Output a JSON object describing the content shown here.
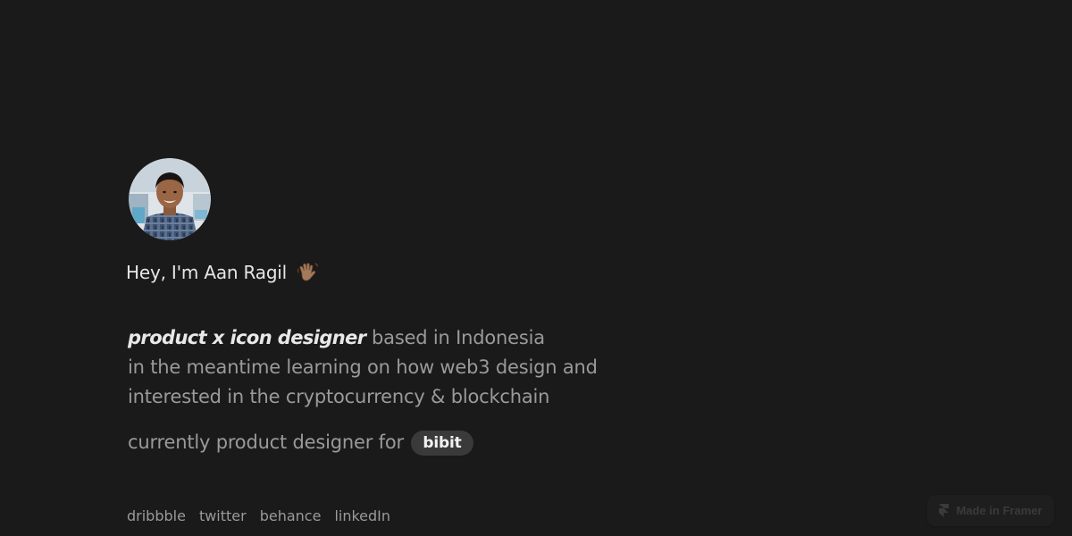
{
  "profile": {
    "greeting": "Hey, I'm Aan Ragil",
    "avatar_alt": "avatar"
  },
  "intro": {
    "role": "product x icon designer",
    "line1_rest": "based in Indonesia",
    "line2": "in the meantime learning on how web3 design and",
    "line3": "interested in the cryptocurrency & blockchain"
  },
  "current": {
    "prefix": "currently product designer for",
    "company": "bibit"
  },
  "social": {
    "links": [
      "dribbble",
      "twitter",
      "behance",
      "linkedIn"
    ]
  },
  "framer_badge": {
    "label": "Made in Framer"
  },
  "colors": {
    "background": "#1a1a1a",
    "text_primary": "#e6e6e6",
    "text_secondary": "#9a9a9a",
    "badge_bg": "#3a3a3a"
  },
  "icons": {
    "wave": "waving-hand-icon",
    "framer": "framer-logo-icon"
  }
}
